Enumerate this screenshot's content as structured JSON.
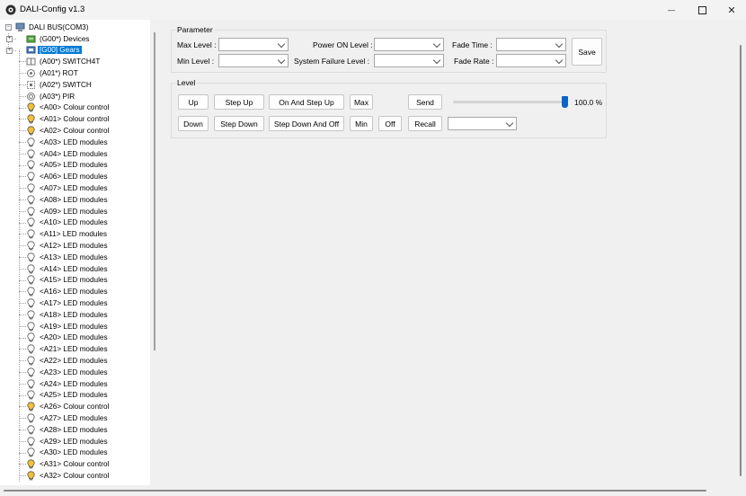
{
  "window": {
    "title": "DALI-Config v1.3",
    "minimize": "—",
    "close": "✕"
  },
  "tree": {
    "root": "DALI BUS(COM3)",
    "children": [
      {
        "label": "(G00*) Devices",
        "icon": "devices-icon",
        "expander": "+"
      },
      {
        "label": "[G00] Gears",
        "icon": "gears-icon",
        "expander": "+",
        "selected": true
      }
    ],
    "devices": [
      {
        "label": "(A00*) SWITCH4T",
        "icon": "switch4t-icon"
      },
      {
        "label": "(A01*) ROT",
        "icon": "rotary-icon"
      },
      {
        "label": "(A02*) SWITCH",
        "icon": "switch-icon"
      },
      {
        "label": "(A03*) PIR",
        "icon": "pir-sensor-icon"
      }
    ],
    "gears": [
      {
        "label": "<A00> Colour control",
        "color": true
      },
      {
        "label": "<A01> Colour control",
        "color": true
      },
      {
        "label": "<A02> Colour control",
        "color": true
      },
      {
        "label": "<A03> LED modules"
      },
      {
        "label": "<A04> LED modules"
      },
      {
        "label": "<A05> LED modules"
      },
      {
        "label": "<A06> LED modules"
      },
      {
        "label": "<A07> LED modules"
      },
      {
        "label": "<A08> LED modules"
      },
      {
        "label": "<A09> LED modules"
      },
      {
        "label": "<A10> LED modules"
      },
      {
        "label": "<A11> LED modules"
      },
      {
        "label": "<A12> LED modules"
      },
      {
        "label": "<A13> LED modules"
      },
      {
        "label": "<A14> LED modules"
      },
      {
        "label": "<A15> LED modules"
      },
      {
        "label": "<A16> LED modules"
      },
      {
        "label": "<A17> LED modules"
      },
      {
        "label": "<A18> LED modules"
      },
      {
        "label": "<A19> LED modules"
      },
      {
        "label": "<A20> LED modules"
      },
      {
        "label": "<A21> LED modules"
      },
      {
        "label": "<A22> LED modules"
      },
      {
        "label": "<A23> LED modules"
      },
      {
        "label": "<A24> LED modules"
      },
      {
        "label": "<A25> LED modules"
      },
      {
        "label": "<A26> Colour control",
        "color": true
      },
      {
        "label": "<A27> LED modules"
      },
      {
        "label": "<A28> LED modules"
      },
      {
        "label": "<A29> LED modules"
      },
      {
        "label": "<A30> LED modules"
      },
      {
        "label": "<A31> Colour control",
        "color": true
      },
      {
        "label": "<A32> Colour control",
        "color": true
      }
    ]
  },
  "parameter": {
    "title": "Parameter",
    "max_level": "Max Level :",
    "min_level": "Min Level :",
    "power_on_level": "Power ON Level :",
    "system_failure_level": "System Failure Level :",
    "fade_time": "Fade Time :",
    "fade_rate": "Fade Rate :",
    "save": "Save"
  },
  "level": {
    "title": "Level",
    "up": "Up",
    "step_up": "Step Up",
    "on_and_step_up": "On And Step Up",
    "max": "Max",
    "send": "Send",
    "down": "Down",
    "step_down": "Step Down",
    "step_down_and_off": "Step Down And Off",
    "min": "Min",
    "off": "Off",
    "recall": "Recall",
    "percent": "100.0 %",
    "slider_value": 1.0
  },
  "colors": {
    "selection": "#0078d7",
    "slider": "#0a64c8",
    "bulb": "#f3c03a"
  }
}
